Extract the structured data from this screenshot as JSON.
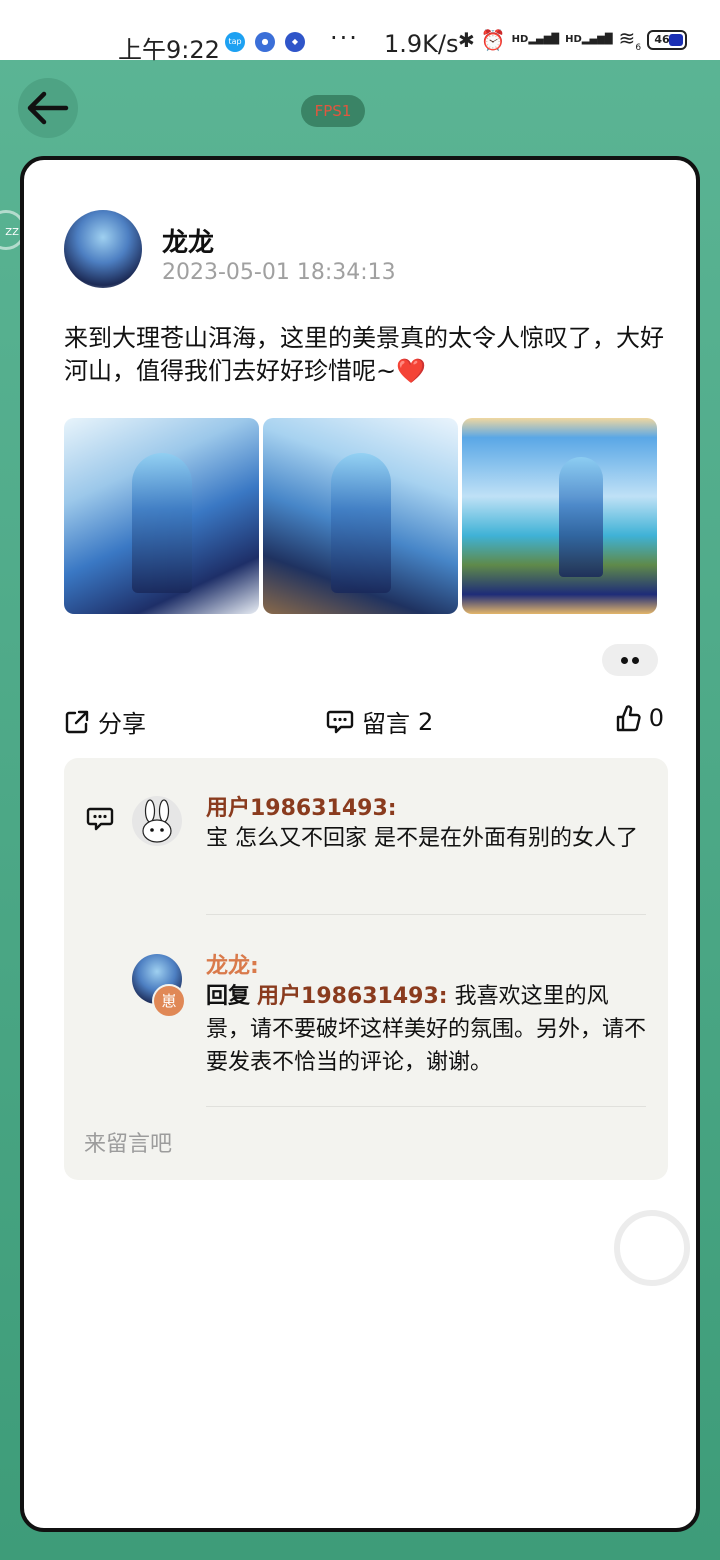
{
  "status_bar": {
    "time": "上午9:22",
    "dots": "···",
    "net_speed": "1.9K/s",
    "signal_badge": "HD",
    "wifi_badge": "6",
    "battery": "46",
    "battery_color": "#1a2fb3"
  },
  "nav": {
    "back_icon": "arrow-left-icon",
    "fps_label": "FPS1"
  },
  "side_widget": "ZZ",
  "post": {
    "author": "龙龙",
    "time": "2023-05-01 18:34:13",
    "text": "来到大理苍山洱海，这里的美景真的太令人惊叹了，大好河山，值得我们去好好珍惜呢~",
    "emoji": "❤️",
    "images": [
      "anime-girl-portrait",
      "anime-girl-seated",
      "anime-girl-seaside"
    ]
  },
  "actions": {
    "share_label": "分享",
    "comment_label": "留言",
    "comment_count": "2",
    "like_count": "0"
  },
  "comments": {
    "items": [
      {
        "user": "用户198631493:",
        "text": "宝 怎么又不回家 是不是在外面有别的女人了"
      }
    ],
    "reply": {
      "user": "龙龙:",
      "badge": "崽",
      "prefix": "回复",
      "target": "用户198631493:",
      "text": "我喜欢这里的风景，请不要破坏这样美好的氛围。另外，请不要发表不恰当的评论，谢谢。"
    },
    "input_placeholder": "来留言吧"
  },
  "colors": {
    "background": "#4ea384",
    "username_brown": "#8a3b1e",
    "reply_orange": "#d97a4b"
  }
}
